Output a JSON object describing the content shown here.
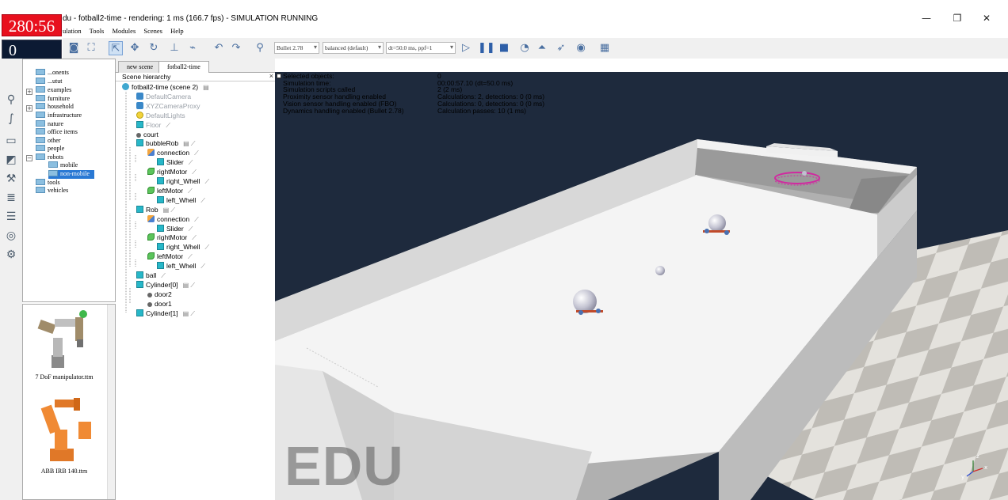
{
  "window": {
    "title": "du - fotball2-time - rendering: 1 ms (166.7 fps) - SIMULATION RUNNING",
    "controls": {
      "minimize": "—",
      "maximize": "❐",
      "close": "✕"
    }
  },
  "overlay": {
    "timer": "280:56",
    "score_a": "0",
    "score_b": "0"
  },
  "menu": [
    "ulation",
    "Tools",
    "Modules",
    "Scenes",
    "Help"
  ],
  "toolbar": {
    "engine": "Bullet 2.78",
    "mode": "balanced (default)",
    "timestep": "dt=50.0 ms, ppf=1",
    "icons": [
      "screenshot-icon",
      "fit-view-icon",
      "select-icon",
      "translate-icon",
      "rotate-icon",
      "assemble-icon",
      "path-icon",
      "undo-icon",
      "redo-icon",
      "pick-icon",
      "play-icon",
      "pause-icon",
      "stop-icon",
      "realtime-icon",
      "slow-icon",
      "fast-icon",
      "eye-icon",
      "layers-icon"
    ]
  },
  "model_browser": {
    "items": [
      {
        "label": "...onents",
        "sel": false
      },
      {
        "label": "...utut",
        "sel": false
      },
      {
        "label": "examples",
        "sel": false
      },
      {
        "label": "furniture",
        "sel": false
      },
      {
        "label": "household",
        "sel": false
      },
      {
        "label": "infrastructure",
        "sel": false
      },
      {
        "label": "nature",
        "sel": false
      },
      {
        "label": "office items",
        "sel": false
      },
      {
        "label": "other",
        "sel": false
      },
      {
        "label": "people",
        "sel": false
      },
      {
        "label": "robots",
        "sel": false
      },
      {
        "label": "mobile",
        "sel": false
      },
      {
        "label": "non-mobile",
        "sel": true
      },
      {
        "label": "tools",
        "sel": false
      },
      {
        "label": "vehicles",
        "sel": false
      }
    ],
    "thumbnails": [
      "7 DoF manipulator.ttm",
      "ABB IRB 140.ttm"
    ]
  },
  "scene": {
    "tabs": [
      "new scene",
      "fotball2-time"
    ],
    "hierarchy_title": "Scene hierarchy",
    "close": "×",
    "rows": [
      {
        "label": "fotball2-time (scene 2)",
        "icon": "scene",
        "grey": false,
        "extra": "▤"
      },
      {
        "label": "DefaultCamera",
        "icon": "cam",
        "grey": true,
        "extra": ""
      },
      {
        "label": "XYZCameraProxy",
        "icon": "cam",
        "grey": true,
        "extra": ""
      },
      {
        "label": "DefaultLights",
        "icon": "light",
        "grey": true,
        "extra": ""
      },
      {
        "label": "Floor",
        "icon": "cube",
        "grey": true,
        "extra": "⟋"
      },
      {
        "label": "court",
        "icon": "dummy",
        "grey": false,
        "extra": ""
      },
      {
        "label": "bubbleRob",
        "icon": "cube",
        "grey": false,
        "extra": "▤ ⟋"
      },
      {
        "label": "connection",
        "icon": "joint",
        "grey": false,
        "extra": "⟋"
      },
      {
        "label": "Slider",
        "icon": "cube",
        "grey": false,
        "extra": "⟋"
      },
      {
        "label": "rightMotor",
        "icon": "motor",
        "grey": false,
        "extra": "⟋"
      },
      {
        "label": "right_Whell",
        "icon": "cube",
        "grey": false,
        "extra": "⟋"
      },
      {
        "label": "leftMotor",
        "icon": "motor",
        "grey": false,
        "extra": "⟋"
      },
      {
        "label": "left_Whell",
        "icon": "cube",
        "grey": false,
        "extra": "⟋"
      },
      {
        "label": "Rob",
        "icon": "cube",
        "grey": false,
        "extra": "▤ ⟋"
      },
      {
        "label": "connection",
        "icon": "joint",
        "grey": false,
        "extra": "⟋"
      },
      {
        "label": "Slider",
        "icon": "cube",
        "grey": false,
        "extra": "⟋"
      },
      {
        "label": "rightMotor",
        "icon": "motor",
        "grey": false,
        "extra": "⟋"
      },
      {
        "label": "right_Whell",
        "icon": "cube",
        "grey": false,
        "extra": "⟋"
      },
      {
        "label": "leftMotor",
        "icon": "motor",
        "grey": false,
        "extra": "⟋"
      },
      {
        "label": "left_Whell",
        "icon": "cube",
        "grey": false,
        "extra": "⟋"
      },
      {
        "label": "ball",
        "icon": "cube",
        "grey": false,
        "extra": "⟋"
      },
      {
        "label": "Cylinder[0]",
        "icon": "cube",
        "grey": false,
        "extra": "▤ ⟋"
      },
      {
        "label": "door2",
        "icon": "dummy",
        "grey": false,
        "extra": ""
      },
      {
        "label": "door1",
        "icon": "dummy",
        "grey": false,
        "extra": ""
      },
      {
        "label": "Cylinder[1]",
        "icon": "cube",
        "grey": false,
        "extra": "▤ ⟋"
      }
    ]
  },
  "sim_info": {
    "labels": [
      "Selected objects:",
      "Simulation time:",
      "Simulation scripts called",
      "Proximity sensor handling enabled",
      "Vision sensor handling enabled (FBO)",
      "Dynamics handling enabled (Bullet 2.78)"
    ],
    "values": [
      "0",
      "00:00:57.10 (dt=50.0 ms)",
      "2 (2 ms)",
      "Calculations: 2, detections: 0 (0 ms)",
      "Calculations: 0, detections: 0 (0 ms)",
      "Calculation passes: 10 (1 ms)"
    ]
  },
  "watermark": "EDU",
  "axes": {
    "x": "x",
    "y": "y",
    "z": "z"
  }
}
